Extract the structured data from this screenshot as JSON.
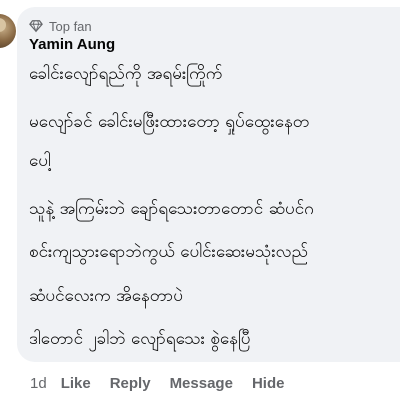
{
  "comment": {
    "badge": "Top fan",
    "author": "Yamin Aung",
    "lines": [
      "ခေါင်းလျော်ရည်ကို အရမ်းကြိုက်",
      "မလျော်ခင် ခေါင်းမဖြီးထားတော့ ရှုပ်ထွေးနေတ",
      "ပေါ့",
      "သူနဲ့ အကြမ်းဘဲ ချော်ရသေးတာတောင် ဆံပင်ဂ",
      "စင်းကျသွားရောဘဲကွယ် ပေါင်းဆေးမသုံးလည်",
      "ဆံပင်လေးက အိနေတာပဲ",
      "ဒါတောင် ၂ခါဘဲ လျော်ရသေး စွဲနေပြီ"
    ]
  },
  "actions": {
    "time": "1d",
    "like": "Like",
    "reply": "Reply",
    "message": "Message",
    "hide": "Hide"
  },
  "colors": {
    "bubble": "#f0f2f5",
    "secondary_text": "#65676b",
    "primary_text": "#050505"
  },
  "icons": {
    "badge": "diamond-icon"
  }
}
